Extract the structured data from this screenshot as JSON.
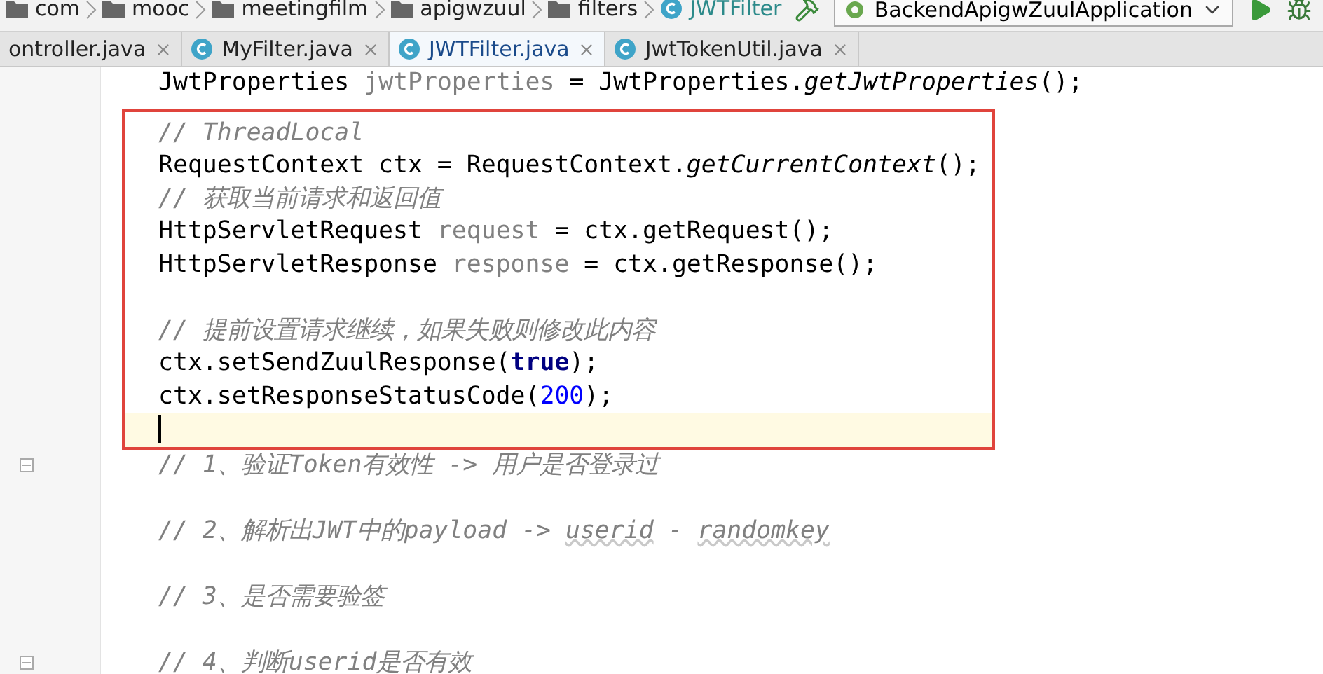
{
  "breadcrumb": [
    {
      "kind": "folder",
      "label": "com"
    },
    {
      "kind": "folder",
      "label": "mooc"
    },
    {
      "kind": "folder",
      "label": "meetingfilm"
    },
    {
      "kind": "folder",
      "label": "apigwzuul"
    },
    {
      "kind": "folder",
      "label": "filters"
    },
    {
      "kind": "class",
      "label": "JWTFilter"
    }
  ],
  "run_config": {
    "label": "BackendApigwZuulApplication"
  },
  "tabs": [
    {
      "label": "ontroller.java",
      "selected": false
    },
    {
      "label": "MyFilter.java",
      "selected": false
    },
    {
      "label": "JWTFilter.java",
      "selected": true
    },
    {
      "label": "JwtTokenUtil.java",
      "selected": false
    }
  ],
  "code_before": [
    {
      "kind": "code",
      "segments": [
        {
          "kind": "plain",
          "text": "JwtProperties "
        },
        {
          "kind": "unused",
          "text": "jwtProperties"
        },
        {
          "kind": "plain",
          "text": " = JwtProperties."
        },
        {
          "kind": "static",
          "text": "getJwtProperties"
        },
        {
          "kind": "plain",
          "text": "();"
        }
      ]
    }
  ],
  "highlighted_block": [
    {
      "kind": "code",
      "segments": [
        {
          "kind": "comment",
          "text": "// ThreadLocal"
        }
      ]
    },
    {
      "kind": "code",
      "segments": [
        {
          "kind": "plain",
          "text": "RequestContext ctx = RequestContext."
        },
        {
          "kind": "static",
          "text": "getCurrentContext"
        },
        {
          "kind": "plain",
          "text": "();"
        }
      ]
    },
    {
      "kind": "code",
      "segments": [
        {
          "kind": "comment",
          "text": "// 获取当前请求和返回值"
        }
      ]
    },
    {
      "kind": "code",
      "segments": [
        {
          "kind": "plain",
          "text": "HttpServletRequest "
        },
        {
          "kind": "unused",
          "text": "request"
        },
        {
          "kind": "plain",
          "text": " = ctx.getRequest();"
        }
      ]
    },
    {
      "kind": "code",
      "segments": [
        {
          "kind": "plain",
          "text": "HttpServletResponse "
        },
        {
          "kind": "unused",
          "text": "response"
        },
        {
          "kind": "plain",
          "text": " = ctx.getResponse();"
        }
      ]
    },
    {
      "kind": "blank"
    },
    {
      "kind": "code",
      "segments": [
        {
          "kind": "comment",
          "text": "// 提前设置请求继续，如果失败则修改此内容"
        }
      ]
    },
    {
      "kind": "code",
      "segments": [
        {
          "kind": "plain",
          "text": "ctx.setSendZuulResponse("
        },
        {
          "kind": "keyword",
          "text": "true"
        },
        {
          "kind": "plain",
          "text": ");"
        }
      ]
    },
    {
      "kind": "code",
      "segments": [
        {
          "kind": "plain",
          "text": "ctx.setResponseStatusCode("
        },
        {
          "kind": "number",
          "text": "200"
        },
        {
          "kind": "plain",
          "text": ");"
        }
      ]
    },
    {
      "kind": "cursor"
    }
  ],
  "code_after": [
    {
      "kind": "code",
      "fold": true,
      "segments": [
        {
          "kind": "comment",
          "text": "// 1、验证Token有效性 -> 用户是否登录过"
        }
      ]
    },
    {
      "kind": "blank"
    },
    {
      "kind": "code",
      "segments": [
        {
          "kind": "comment",
          "text": "// 2、解析出JWT中的payload -> "
        },
        {
          "kind": "typo",
          "text": "userid"
        },
        {
          "kind": "comment",
          "text": " - "
        },
        {
          "kind": "typo",
          "text": "randomkey"
        }
      ]
    },
    {
      "kind": "blank"
    },
    {
      "kind": "code",
      "segments": [
        {
          "kind": "comment",
          "text": "// 3、是否需要验签"
        }
      ]
    },
    {
      "kind": "blank"
    },
    {
      "kind": "code",
      "fold": true,
      "segments": [
        {
          "kind": "comment",
          "text": "// 4、判断userid是否有效"
        }
      ]
    }
  ]
}
